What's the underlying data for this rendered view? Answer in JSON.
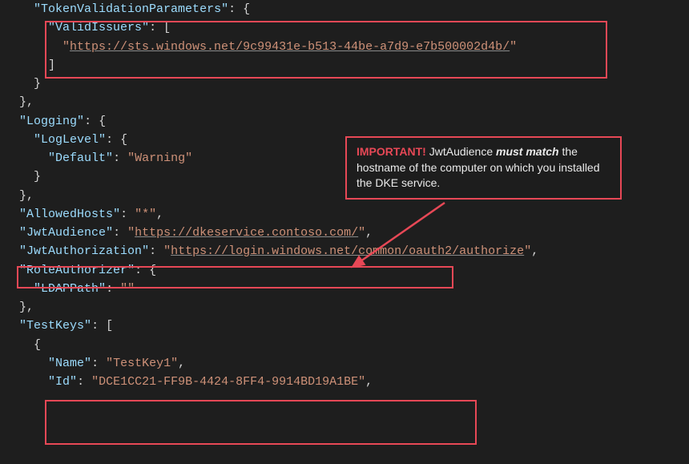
{
  "code": {
    "tokenValidationParameters": "TokenValidationParameters",
    "validIssuers": "ValidIssuers",
    "validIssuerUrl": "https://sts.windows.net/9c99431e-b513-44be-a7d9-e7b500002d4b/",
    "logging": "Logging",
    "logLevel": "LogLevel",
    "default": "Default",
    "warning": "Warning",
    "allowedHosts": "AllowedHosts",
    "allowedHostsValue": "*",
    "jwtAudience": "JwtAudience",
    "jwtAudienceUrl": "https://dkeservice.contoso.com/",
    "jwtAuthorization": "JwtAuthorization",
    "jwtAuthorizationUrl": "https://login.windows.net/common/oauth2/authorize",
    "roleAuthorizer": "RoleAuthorizer",
    "ldapPath": "LDAPPath",
    "ldapPathValue": "",
    "testKeys": "TestKeys",
    "name": "Name",
    "nameValue": "TestKey1",
    "id": "Id",
    "idValue": "DCE1CC21-FF9B-4424-8FF4-9914BD19A1BE"
  },
  "callout": {
    "important": "IMPORTANT!",
    "text1": " JwtAudience ",
    "mustMatch": "must match",
    "text2": " the hostname of the computer on which you installed the DKE service."
  }
}
